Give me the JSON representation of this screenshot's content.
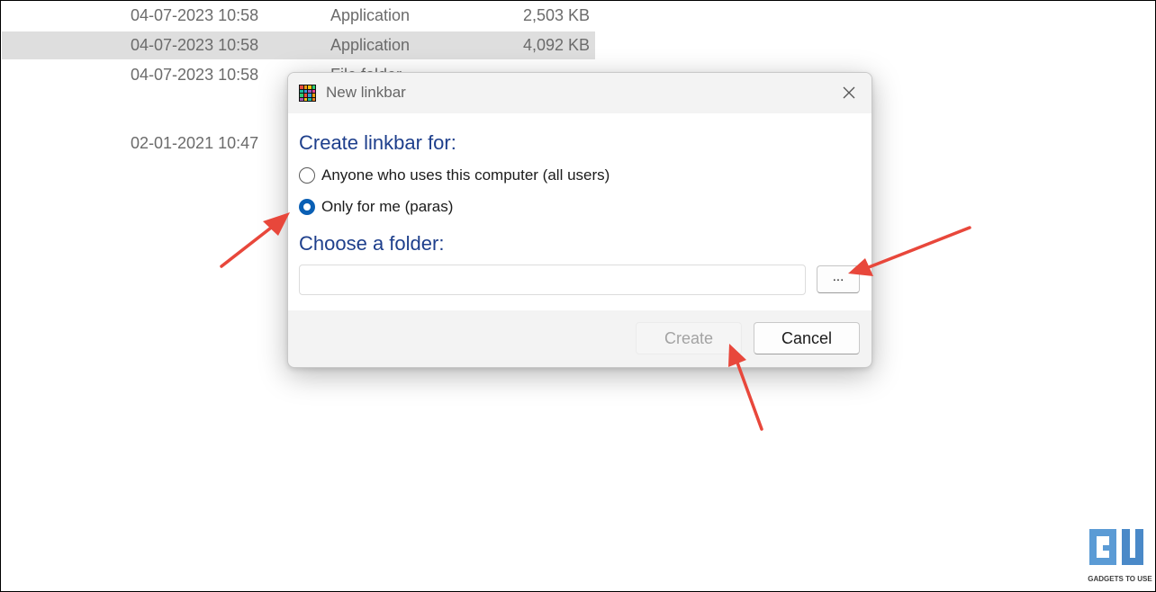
{
  "file_list": {
    "rows": [
      {
        "date": "04-07-2023 10:58",
        "type": "Application",
        "size": "2,503 KB",
        "selected": false
      },
      {
        "date": "04-07-2023 10:58",
        "type": "Application",
        "size": "4,092 KB",
        "selected": true
      },
      {
        "date": "04-07-2023 10:58",
        "type": "File folder",
        "size": "",
        "selected": false
      },
      {
        "date": "02-01-2021 10:47",
        "type": "",
        "size": "",
        "selected": false
      }
    ]
  },
  "dialog": {
    "title": "New linkbar",
    "close_icon": "close-icon",
    "create_for_heading": "Create linkbar for:",
    "options": [
      {
        "label": "Anyone who uses this computer (all users)",
        "checked": false
      },
      {
        "label": "Only for me (paras)",
        "checked": true
      }
    ],
    "folder_heading": "Choose a folder:",
    "folder_value": "",
    "browse_label": "...",
    "create_label": "Create",
    "create_enabled": false,
    "cancel_label": "Cancel"
  },
  "colors": {
    "heading": "#1e3f8c",
    "radio_checked": "#0a5fb4",
    "arrow": "#e8473b",
    "selected_row": "#dedede"
  },
  "watermark": {
    "text": "GADGETS TO USE",
    "icon": "gadgets-to-use-logo"
  }
}
